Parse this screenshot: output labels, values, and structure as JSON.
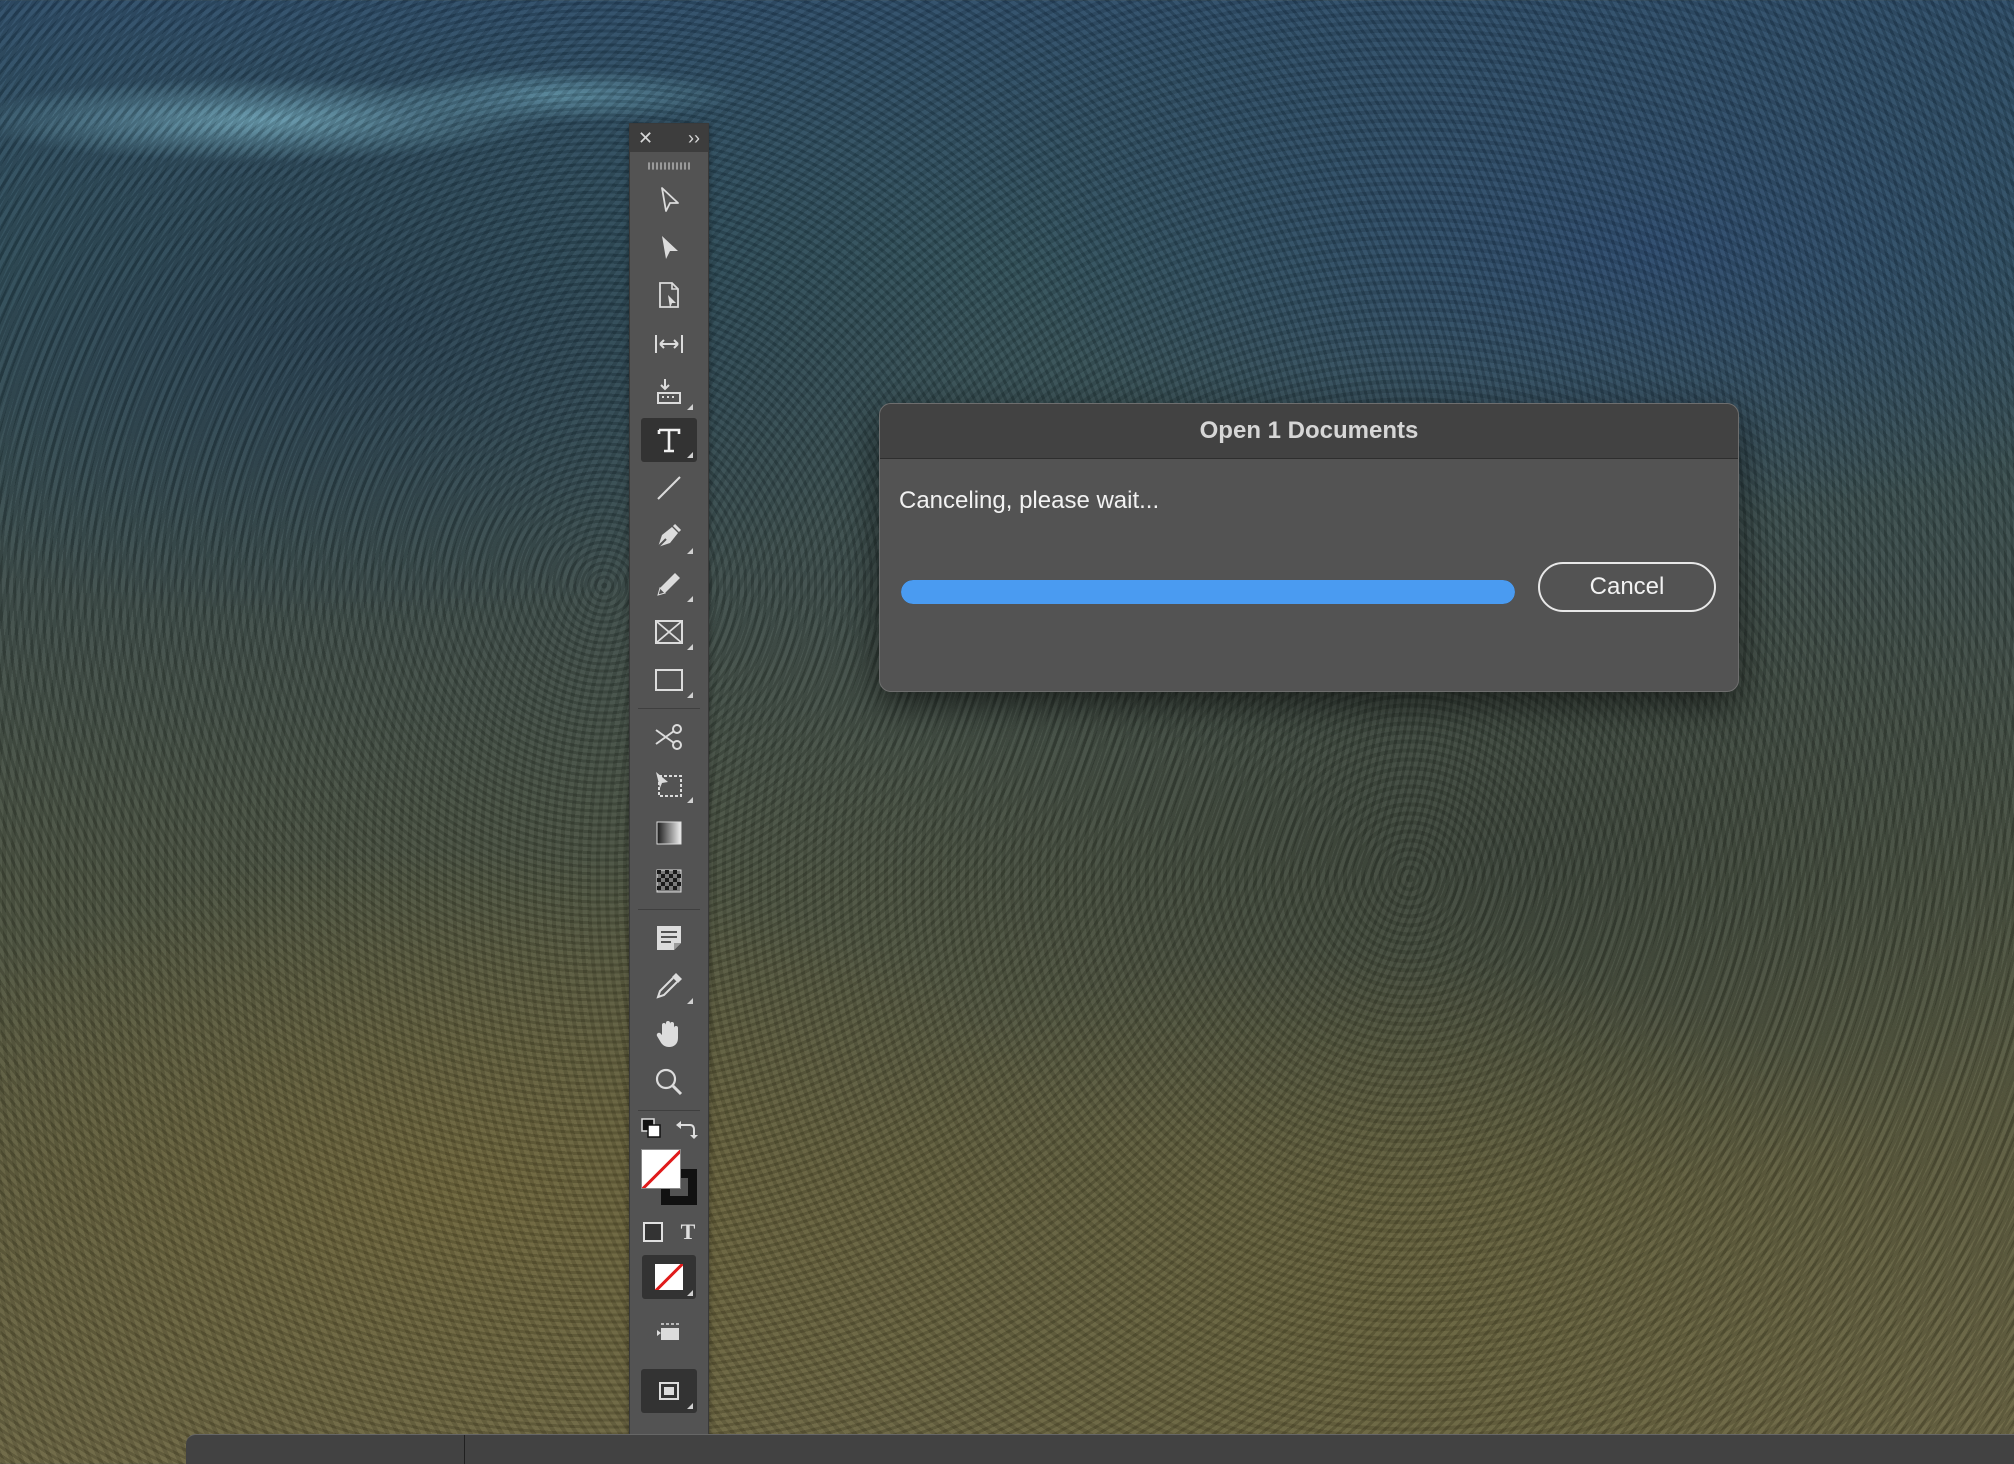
{
  "dialog": {
    "title": "Open 1 Documents",
    "message": "Canceling, please wait...",
    "progress": 1.0,
    "cancel_label": "Cancel",
    "accent": "#4a9bf1"
  },
  "toolbar": {
    "close_glyph": "✕",
    "expand_glyph": "››",
    "tools": [
      {
        "name": "selection-tool",
        "icon": "arrow-outline-icon"
      },
      {
        "name": "direct-selection-tool",
        "icon": "arrow-filled-icon"
      },
      {
        "name": "page-tool",
        "icon": "page-icon"
      },
      {
        "name": "gap-tool",
        "icon": "gap-icon"
      },
      {
        "name": "content-collector-tool",
        "icon": "content-collector-icon"
      },
      {
        "name": "type-tool",
        "icon": "type-icon",
        "active": true
      },
      {
        "name": "line-tool",
        "icon": "line-icon"
      },
      {
        "name": "pen-tool",
        "icon": "pen-icon"
      },
      {
        "name": "pencil-tool",
        "icon": "pencil-icon"
      },
      {
        "name": "rectangle-frame-tool",
        "icon": "rectangle-frame-icon"
      },
      {
        "name": "rectangle-tool",
        "icon": "rectangle-icon"
      },
      {
        "name": "scissors-tool",
        "icon": "scissors-icon"
      },
      {
        "name": "free-transform-tool",
        "icon": "free-transform-icon"
      },
      {
        "name": "gradient-swatch-tool",
        "icon": "gradient-icon"
      },
      {
        "name": "gradient-feather-tool",
        "icon": "gradient-feather-icon"
      },
      {
        "name": "note-tool",
        "icon": "note-icon"
      },
      {
        "name": "eyedropper-tool",
        "icon": "eyedropper-icon"
      },
      {
        "name": "hand-tool",
        "icon": "hand-icon"
      },
      {
        "name": "zoom-tool",
        "icon": "zoom-icon"
      }
    ],
    "type_glyph": "T",
    "fill_color": "#ffffff",
    "stroke_color": "#111111",
    "none_color": "#e01b1b"
  }
}
